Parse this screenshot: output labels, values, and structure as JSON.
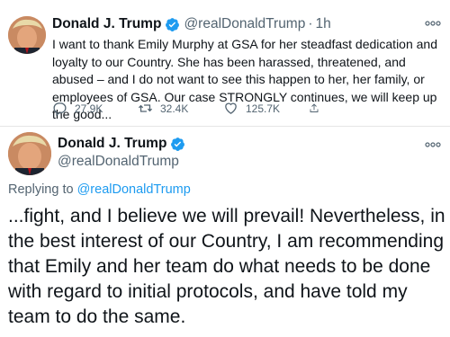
{
  "tweet1": {
    "author_name": "Donald J. Trump",
    "handle": "@realDonaldTrump",
    "separator": "·",
    "time": "1h",
    "text": "I want to thank Emily Murphy at GSA for her steadfast dedication and loyalty to our Country. She has been harassed, threatened, and abused – and I do not want to see this happen to her, her family, or employees of GSA. Our case STRONGLY continues, we will keep up the good...",
    "replies": "27.9K",
    "retweets": "32.4K",
    "likes": "125.7K",
    "more_icon": "more-dots-icon"
  },
  "tweet2": {
    "author_name": "Donald J. Trump",
    "handle": "@realDonaldTrump",
    "replying_prefix": "Replying to",
    "replying_to": "@realDonaldTrump",
    "text": "...fight, and I believe we will prevail! Nevertheless, in the best interest of our Country, I am recommending that Emily and her team do what needs to be done with regard to initial protocols, and have told my team to do the same.",
    "more_icon": "more-dots-icon"
  },
  "colors": {
    "accent": "#1d9bf0",
    "secondary_text": "#536471",
    "primary_text": "#0f1419"
  }
}
